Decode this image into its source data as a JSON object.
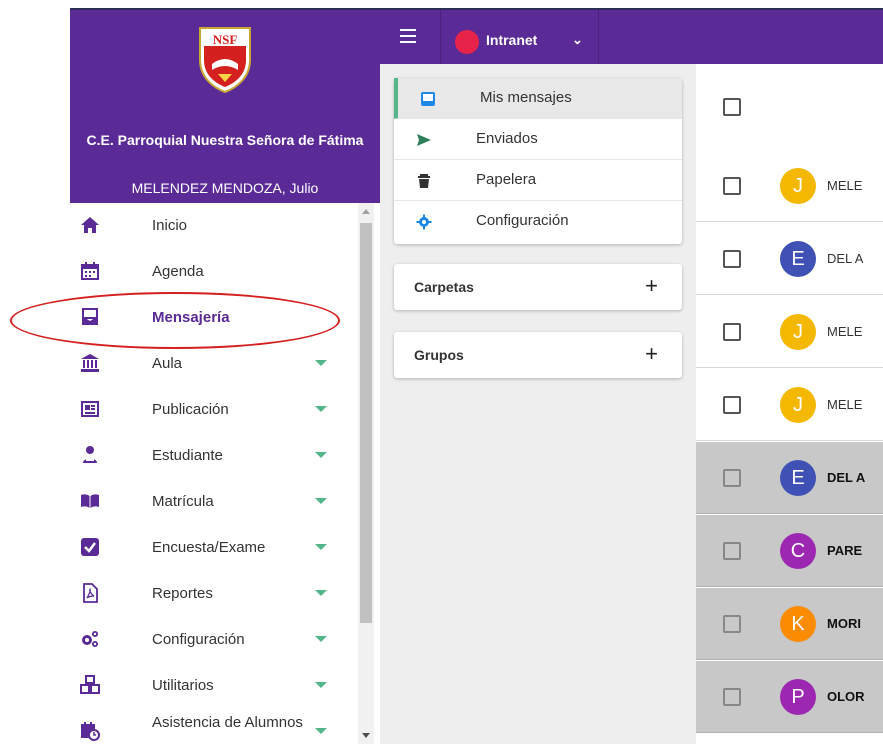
{
  "sidebar": {
    "school_name": "C.E. Parroquial Nuestra Señora de Fátima",
    "user_name": "MELENDEZ MENDOZA, Julio",
    "crest_text": "NSF",
    "items": [
      {
        "label": "Inicio",
        "icon": "home-icon",
        "expandable": false
      },
      {
        "label": "Agenda",
        "icon": "calendar-icon",
        "expandable": false
      },
      {
        "label": "Mensajería",
        "icon": "envelope-icon",
        "expandable": false,
        "active": true
      },
      {
        "label": "Aula",
        "icon": "institution-icon",
        "expandable": true
      },
      {
        "label": "Publicación",
        "icon": "newspaper-icon",
        "expandable": true
      },
      {
        "label": "Estudiante",
        "icon": "student-icon",
        "expandable": true
      },
      {
        "label": "Matrícula",
        "icon": "book-open-icon",
        "expandable": true
      },
      {
        "label": "Encuesta/Exame",
        "icon": "checkbox-icon",
        "expandable": true
      },
      {
        "label": "Reportes",
        "icon": "pdf-file-icon",
        "expandable": true
      },
      {
        "label": "Configuración",
        "icon": "cogs-icon",
        "expandable": true
      },
      {
        "label": "Utilitarios",
        "icon": "cubes-icon",
        "expandable": true
      },
      {
        "label": "Asistencia de Alumnos",
        "icon": "calendar-clock-icon",
        "expandable": true
      }
    ]
  },
  "topbar": {
    "site_label": "Intranet",
    "accent": "#5a2a96",
    "dot_color": "#e8234a"
  },
  "mail_menu": {
    "items": [
      {
        "label": "Mis mensajes",
        "icon": "inbox-icon",
        "active": true
      },
      {
        "label": "Enviados",
        "icon": "send-icon"
      },
      {
        "label": "Papelera",
        "icon": "trash-icon"
      },
      {
        "label": "Configuración",
        "icon": "gear-icon"
      }
    ],
    "carpetas_label": "Carpetas",
    "grupos_label": "Grupos",
    "add_symbol": "+"
  },
  "messages": [
    {
      "initial": "J",
      "sender": "MELE",
      "color": "#f5b800",
      "unread": false
    },
    {
      "initial": "E",
      "sender": "DEL A",
      "color": "#3f51b5",
      "unread": false
    },
    {
      "initial": "J",
      "sender": "MELE",
      "color": "#f5b800",
      "unread": false
    },
    {
      "initial": "J",
      "sender": "MELE",
      "color": "#f5b800",
      "unread": false
    },
    {
      "initial": "E",
      "sender": "DEL A",
      "color": "#3f51b5",
      "unread": true
    },
    {
      "initial": "C",
      "sender": "PARE",
      "color": "#9c27b0",
      "unread": true
    },
    {
      "initial": "K",
      "sender": "MORI",
      "color": "#fb8c00",
      "unread": true
    },
    {
      "initial": "P",
      "sender": "OLOR",
      "color": "#9c27b0",
      "unread": true
    }
  ]
}
